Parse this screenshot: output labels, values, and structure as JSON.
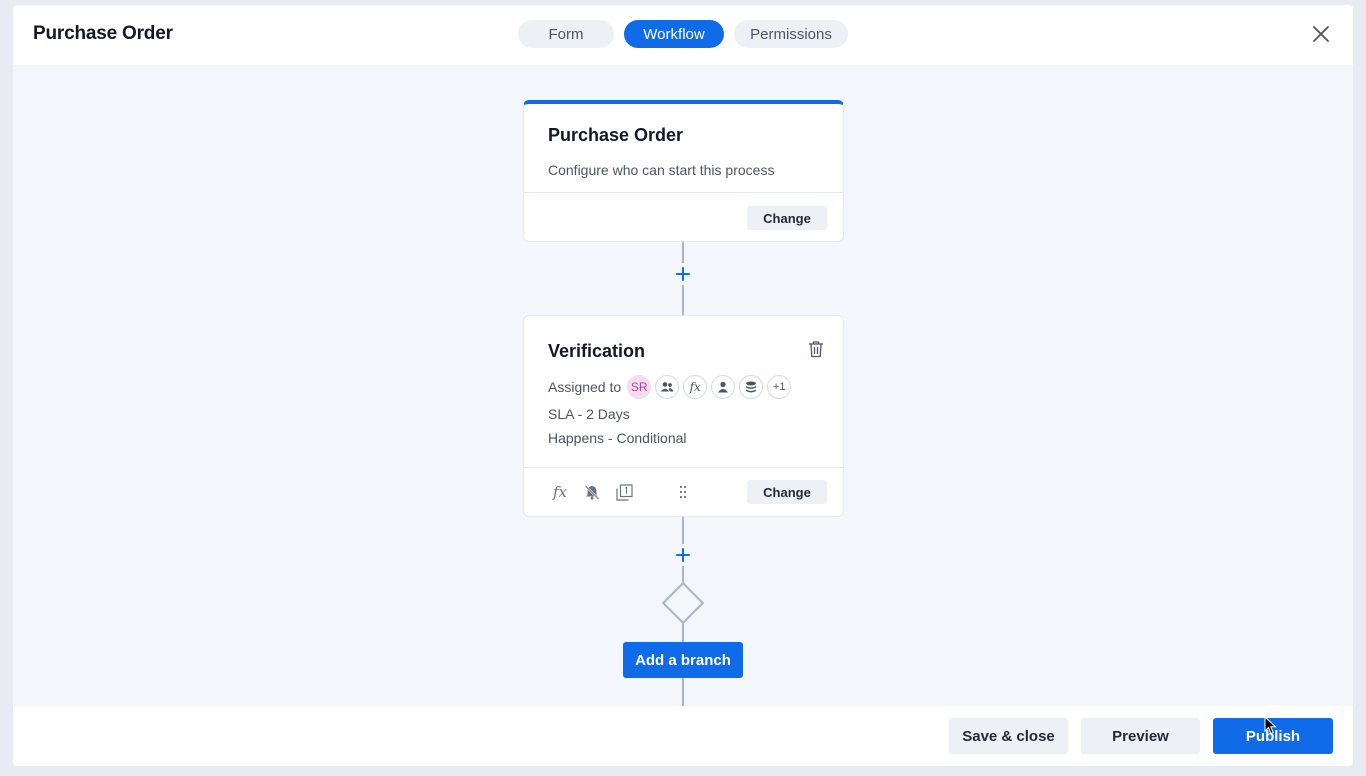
{
  "header": {
    "title": "Purchase Order",
    "tabs": [
      {
        "label": "Form",
        "active": false
      },
      {
        "label": "Workflow",
        "active": true
      },
      {
        "label": "Permissions",
        "active": false
      }
    ],
    "close_icon": "close-icon"
  },
  "workflow": {
    "start_card": {
      "title": "Purchase Order",
      "subtitle": "Configure who can start this process",
      "change_label": "Change"
    },
    "step_card": {
      "title": "Verification",
      "assigned_label": "Assigned to",
      "assignee_initials": "SR",
      "assignee_icons": [
        "group-icon",
        "formula-icon",
        "user-icon",
        "database-icon"
      ],
      "formula_glyph": "fx",
      "more_count": "+1",
      "sla": "SLA - 2 Days",
      "happens": "Happens - Conditional",
      "footer_icons": [
        "formula-icon",
        "notification-mute-icon",
        "copy-icon",
        "drag-handle-icon"
      ],
      "change_label": "Change"
    },
    "add_branch_label": "Add a branch"
  },
  "footer": {
    "save_close": "Save & close",
    "preview": "Preview",
    "publish": "Publish"
  },
  "colors": {
    "accent": "#0f6be8",
    "canvas_bg": "#f3f6fb",
    "connector": "#aab4c5",
    "assignee_chip": "#f5dcef"
  }
}
